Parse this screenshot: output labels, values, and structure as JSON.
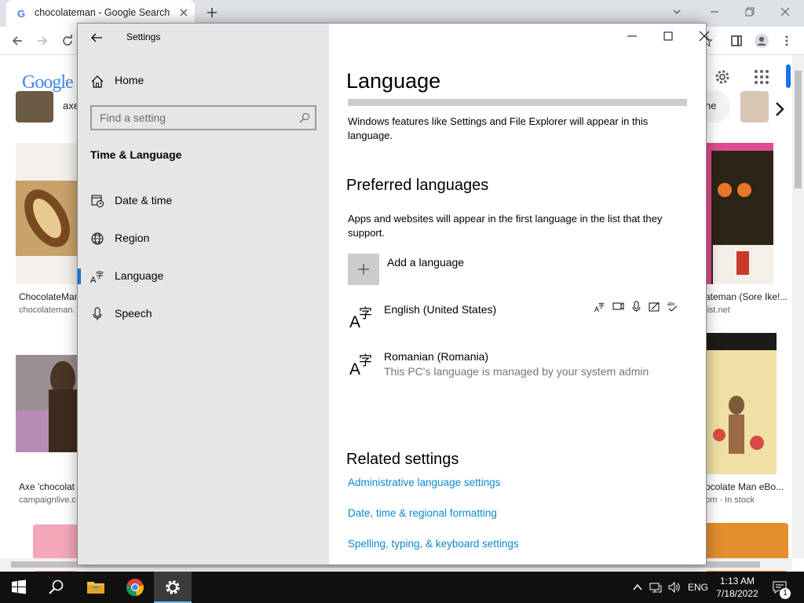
{
  "browser": {
    "tab_title": "chocolateman - Google Search",
    "tab_favicon": "G"
  },
  "google_page": {
    "logo_text": "Google",
    "results_left": [
      {
        "caption": "ChocolateMan",
        "source": "chocolateman."
      },
      {
        "caption": "Axe 'chocolat",
        "source": "campaignlive.c"
      }
    ],
    "results_right": [
      {
        "caption": "ateman (Sore Ike!...",
        "source": "list.net"
      },
      {
        "caption": "ocolate Man eBo...",
        "source": "om · In stock"
      }
    ],
    "chip_left": "axe",
    "chip_right": "ne"
  },
  "settings": {
    "window_title": "Settings",
    "home_label": "Home",
    "search_placeholder": "Find a setting",
    "group_title": "Time & Language",
    "nav": [
      {
        "label": "Date & time",
        "icon": "date-time-icon"
      },
      {
        "label": "Region",
        "icon": "region-globe-icon"
      },
      {
        "label": "Language",
        "icon": "language-icon",
        "selected": true
      },
      {
        "label": "Speech",
        "icon": "microphone-icon"
      }
    ],
    "page_title": "Language",
    "display_desc": "Windows features like Settings and File Explorer will appear in this language.",
    "preferred_title": "Preferred languages",
    "preferred_desc": "Apps and websites will appear in the first language in the list that they support.",
    "add_language": "Add a language",
    "languages": [
      {
        "name": "English (United States)",
        "sub": ""
      },
      {
        "name": "Romanian (Romania)",
        "sub": "This PC's language is managed by your system admin"
      }
    ],
    "related_title": "Related settings",
    "related_links": [
      "Administrative language settings",
      "Date, time & regional formatting",
      "Spelling, typing, & keyboard settings"
    ]
  },
  "taskbar": {
    "input_language": "ENG",
    "time": "1:13 AM",
    "date": "7/18/2022",
    "notification_count": "1"
  },
  "colors": {
    "accent": "#0078d7",
    "link": "#0a8ad0",
    "sidebar_bg": "#e6e6e6"
  }
}
